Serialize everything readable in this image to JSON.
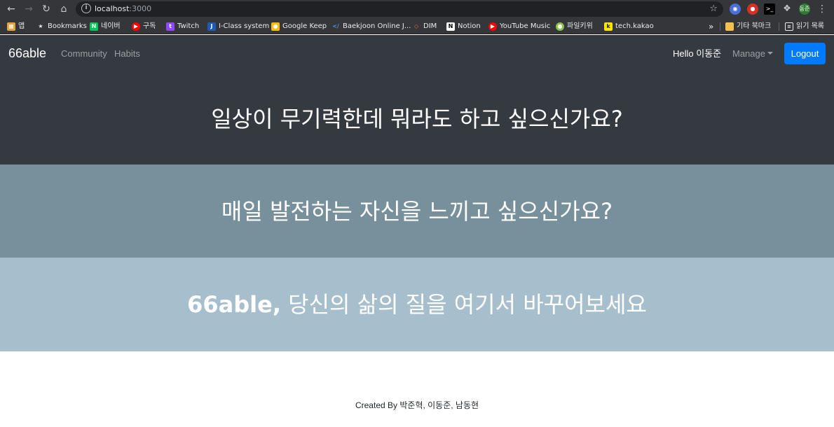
{
  "browser": {
    "url_host": "localhost",
    "url_port": ":3000",
    "bookmarks": [
      {
        "label": "앱",
        "icon": "apps-grid-icon",
        "color": "#e8a23a"
      },
      {
        "label": "Bookmarks",
        "icon": "star-icon",
        "color": "#e8eaed"
      },
      {
        "label": "네이버",
        "icon": "naver-icon",
        "color": "#03c75a"
      },
      {
        "label": "구독",
        "icon": "youtube-icon",
        "color": "#ff0000"
      },
      {
        "label": "Twitch",
        "icon": "twitch-icon",
        "color": "#9146ff"
      },
      {
        "label": "I-Class system",
        "icon": "iclass-icon",
        "color": "#1e5bb8"
      },
      {
        "label": "Google Keep",
        "icon": "google-keep-icon",
        "color": "#fbbc04"
      },
      {
        "label": "Baekjoon Online J...",
        "icon": "baekjoon-icon",
        "color": "#2f6fb1"
      },
      {
        "label": "DIM",
        "icon": "dim-icon",
        "color": "#e0712a"
      },
      {
        "label": "Notion",
        "icon": "notion-icon",
        "color": "#ffffff"
      },
      {
        "label": "YouTube Music",
        "icon": "youtube-music-icon",
        "color": "#ff0000"
      },
      {
        "label": "파일키위",
        "icon": "filekiwi-icon",
        "color": "#8bc34a"
      },
      {
        "label": "tech.kakao",
        "icon": "kakao-icon",
        "color": "#f7e600"
      },
      {
        "label": "기타 북마크",
        "icon": "folder-icon",
        "color": "#f2c04c"
      },
      {
        "label": "읽기 목록",
        "icon": "reading-list-icon",
        "color": "#e8eaed"
      }
    ],
    "overflow_label": "»"
  },
  "navbar": {
    "brand": "66able",
    "links": [
      "Community",
      "Habits"
    ],
    "greeting": "Hello 이동준",
    "manage_label": "Manage",
    "logout_label": "Logout",
    "colors": {
      "bg": "#343a40",
      "primary": "#007bff"
    }
  },
  "hero": {
    "line1": "일상이 무기력한데 뭐라도 하고 싶으신가요?",
    "line2": "매일 발전하는 자신을 느끼고 싶으신가요?",
    "line3_strong": "66able,",
    "line3_rest": " 당신의 삶의 질을 여기서 바꾸어보세요",
    "colors": [
      "#343a40",
      "#78909c",
      "#a7bfcc"
    ]
  },
  "footer": {
    "text": "Created By 박준혁, 이동준, 남동현"
  }
}
